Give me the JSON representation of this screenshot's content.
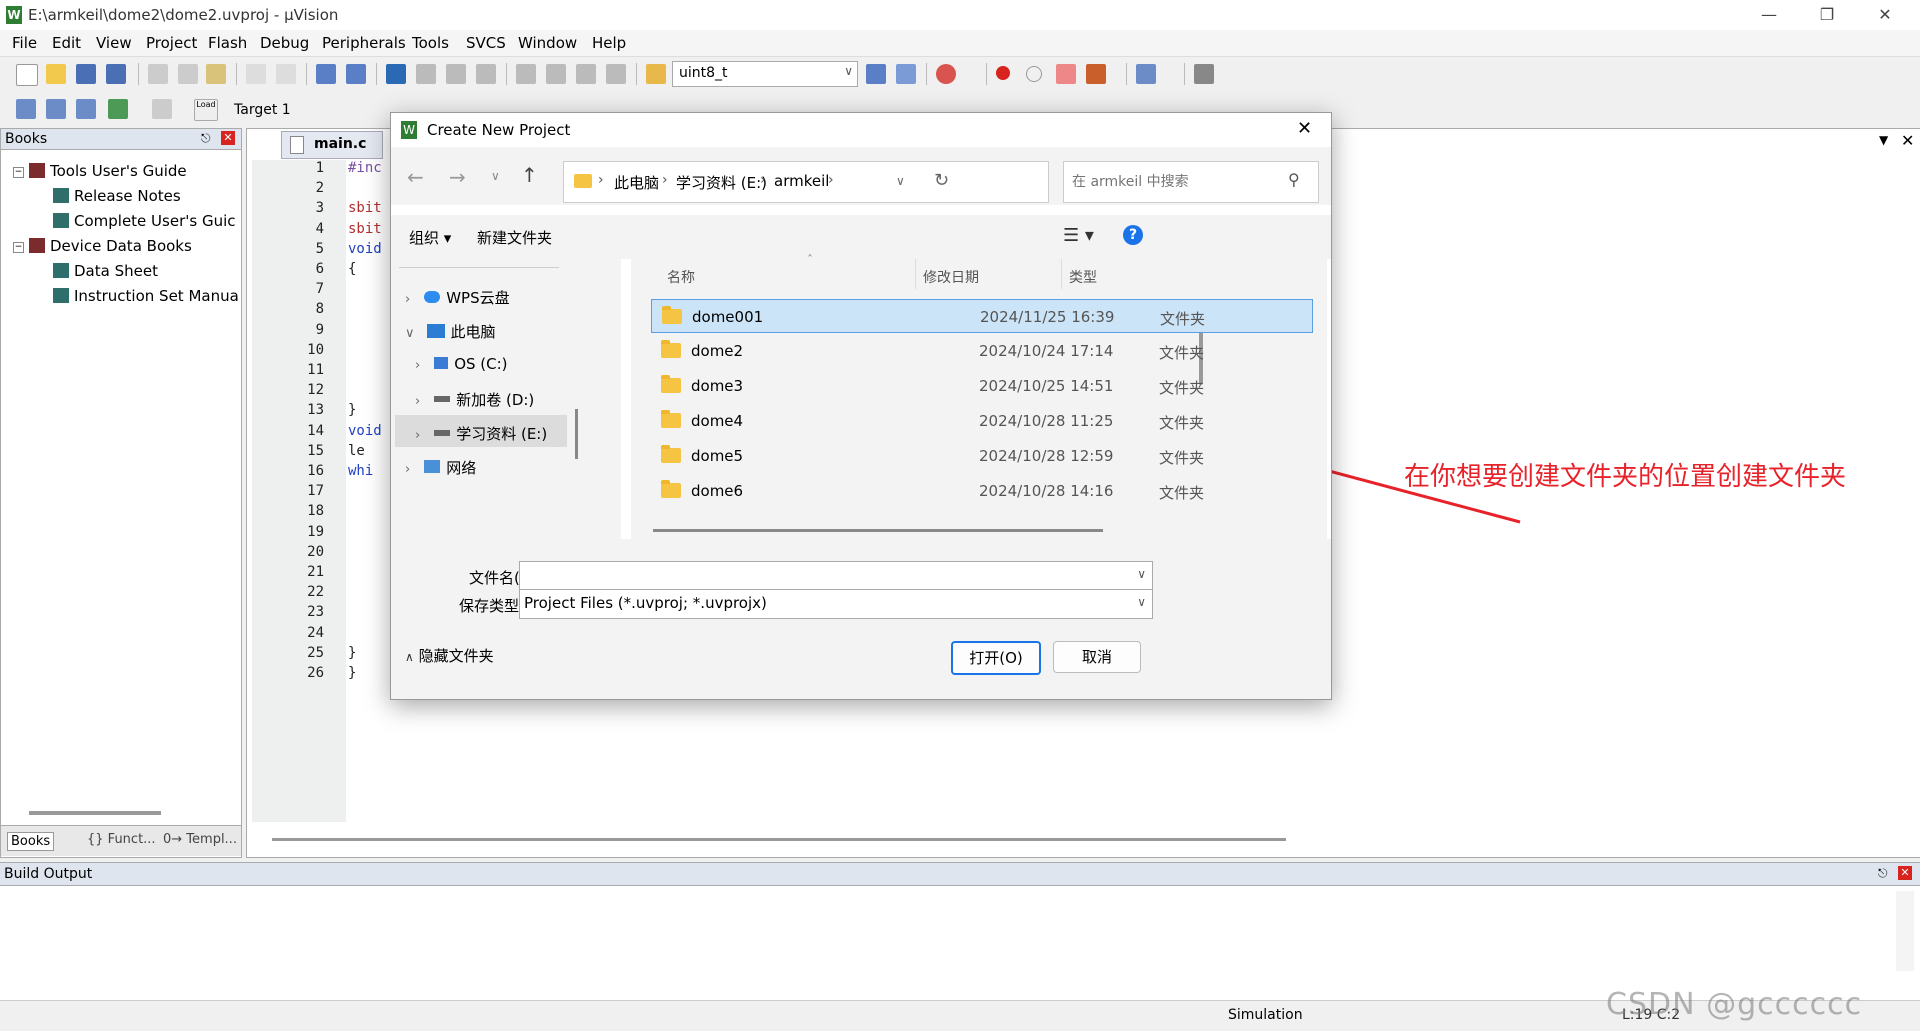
{
  "window": {
    "title": "E:\\armkeil\\dome2\\dome2.uvproj - µVision",
    "app_icon": "W"
  },
  "menu": [
    "File",
    "Edit",
    "View",
    "Project",
    "Flash",
    "Debug",
    "Peripherals",
    "Tools",
    "SVCS",
    "Window",
    "Help"
  ],
  "toolbar": {
    "find_value": "uint8_t",
    "target": "Target 1",
    "load_label": "Load"
  },
  "books": {
    "header": "Books",
    "items": [
      "Tools User's Guide",
      "Release Notes",
      "Complete User's Guic",
      "Device Data Books",
      "Data Sheet",
      "Instruction Set Manua"
    ],
    "tabs": [
      "Books",
      "{} Funct...",
      "0→ Templ..."
    ]
  },
  "editor": {
    "tab": "main.c",
    "line_numbers": [
      "1",
      "2",
      "3",
      "4",
      "5",
      "6",
      "7",
      "8",
      "9",
      "10",
      "11",
      "12",
      "13",
      "14",
      "15",
      "16",
      "17",
      "18",
      "19",
      "20",
      "21",
      "22",
      "23",
      "24",
      "25",
      "26"
    ],
    "lines": [
      "#inc",
      "",
      "sbit",
      "sbit",
      "void",
      "{",
      "",
      "",
      "",
      "",
      "",
      "",
      "}",
      "void",
      "  le",
      "  whi",
      "",
      "",
      "",
      "",
      "",
      "",
      "",
      "",
      "  }",
      "}"
    ]
  },
  "build": {
    "header": "Build Output"
  },
  "status": {
    "mode": "Simulation",
    "position": "L:19 C:2",
    "watermark": "CSDN @gcccccc"
  },
  "dialog": {
    "title": "Create New Project",
    "breadcrumb": [
      "此电脑",
      "学习资料 (E:)",
      "armkeil"
    ],
    "search_placeholder": "在 armkeil 中搜索",
    "organize": "组织",
    "new_folder": "新建文件夹",
    "nav": [
      "WPS云盘",
      "此电脑",
      "OS (C:)",
      "新加卷 (D:)",
      "学习资料 (E:)",
      "网络"
    ],
    "columns": [
      "名称",
      "修改日期",
      "类型"
    ],
    "files": [
      {
        "name": "dome001",
        "date": "2024/11/25 16:39",
        "type": "文件夹"
      },
      {
        "name": "dome2",
        "date": "2024/10/24 17:14",
        "type": "文件夹"
      },
      {
        "name": "dome3",
        "date": "2024/10/25 14:51",
        "type": "文件夹"
      },
      {
        "name": "dome4",
        "date": "2024/10/28 11:25",
        "type": "文件夹"
      },
      {
        "name": "dome5",
        "date": "2024/10/28 12:59",
        "type": "文件夹"
      },
      {
        "name": "dome6",
        "date": "2024/10/28 14:16",
        "type": "文件夹"
      }
    ],
    "filename_label": "文件名(N):",
    "filename_value": "",
    "filetype_label": "保存类型(T):",
    "filetype_value": "Project Files (*.uvproj; *.uvprojx)",
    "hide_folders": "隐藏文件夹",
    "open_button": "打开(O)",
    "cancel_button": "取消"
  },
  "annotation": {
    "text": "在你想要创建文件夹的位置创建文件夹",
    "color": "#e8222a"
  }
}
